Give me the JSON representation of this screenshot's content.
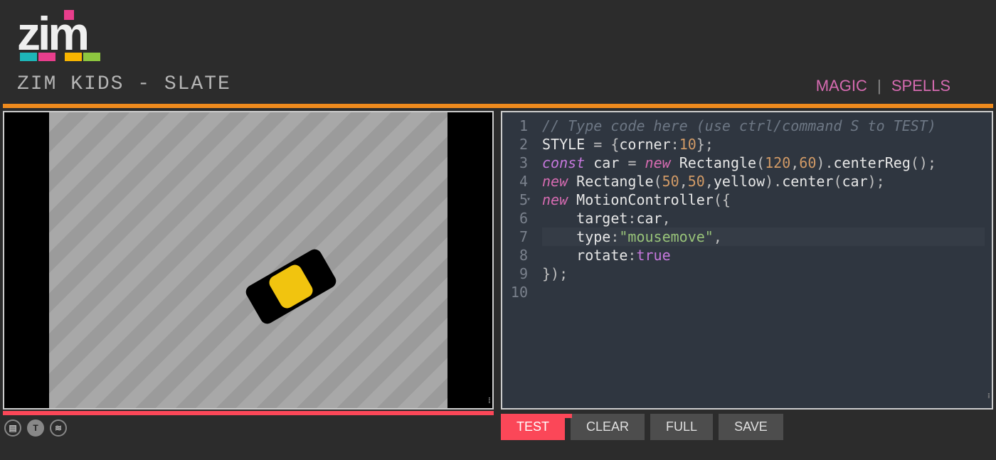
{
  "header": {
    "breadcrumb": "ZIM KIDS - SLATE",
    "links": {
      "magic": "MAGIC",
      "spells": "SPELLS"
    }
  },
  "logo": {
    "letters": "zim",
    "bar_colors": [
      "#1db6b8",
      "#e83e8c",
      "#f8b500",
      "#8dc63f"
    ],
    "dot_color": "#e83e8c"
  },
  "buttons": {
    "test": "TEST",
    "clear": "CLEAR",
    "full": "FULL",
    "save": "SAVE"
  },
  "editor": {
    "line_numbers": [
      "1",
      "2",
      "3",
      "4",
      "5",
      "6",
      "7",
      "8",
      "9",
      "10"
    ],
    "lines": [
      {
        "t": "comment",
        "raw": "// Type code here (use ctrl/command S to TEST)"
      },
      {
        "t": "code",
        "html": "STYLE <span class='tok-punc'>=</span> <span class='tok-punc'>{</span>corner<span class='tok-punc'>:</span><span class='tok-num'>10</span><span class='tok-punc'>};</span>"
      },
      {
        "t": "code",
        "html": "<span class='tok-kw2'>const</span> car <span class='tok-punc'>=</span> <span class='tok-kw'>new</span> Rectangle<span class='tok-punc'>(</span><span class='tok-num'>120</span><span class='tok-punc'>,</span><span class='tok-num'>60</span><span class='tok-punc'>)</span><span class='tok-punc'>.</span>centerReg<span class='tok-punc'>();</span>"
      },
      {
        "t": "code",
        "html": "<span class='tok-kw'>new</span> Rectangle<span class='tok-punc'>(</span><span class='tok-num'>50</span><span class='tok-punc'>,</span><span class='tok-num'>50</span><span class='tok-punc'>,</span>yellow<span class='tok-punc'>)</span><span class='tok-punc'>.</span>center<span class='tok-punc'>(</span>car<span class='tok-punc'>);</span>"
      },
      {
        "t": "code",
        "html": "<span class='tok-kw'>new</span> MotionController<span class='tok-punc'>({</span>"
      },
      {
        "t": "code",
        "html": "    target<span class='tok-punc'>:</span>car<span class='tok-punc'>,</span>"
      },
      {
        "t": "code",
        "cursor": true,
        "html": "    type<span class='tok-punc'>:</span><span class='tok-str'>\"mousemove\"</span><span class='tok-punc'>,</span>"
      },
      {
        "t": "code",
        "html": "    rotate<span class='tok-punc'>:</span><span class='tok-bool'>true</span>"
      },
      {
        "t": "code",
        "html": "<span class='tok-punc'>});</span>"
      },
      {
        "t": "code",
        "html": ""
      }
    ]
  },
  "canvas": {
    "car_rotation_deg": -30,
    "car_size": [
      120,
      60
    ],
    "car_inner_size": [
      50,
      50
    ],
    "car_inner_color": "#f1c40f"
  },
  "colors": {
    "orange": "#ee8a1d",
    "red": "#fb4758",
    "pink": "#d66bb1",
    "bg": "#2c2c2c",
    "editor_bg": "#2f3640"
  }
}
